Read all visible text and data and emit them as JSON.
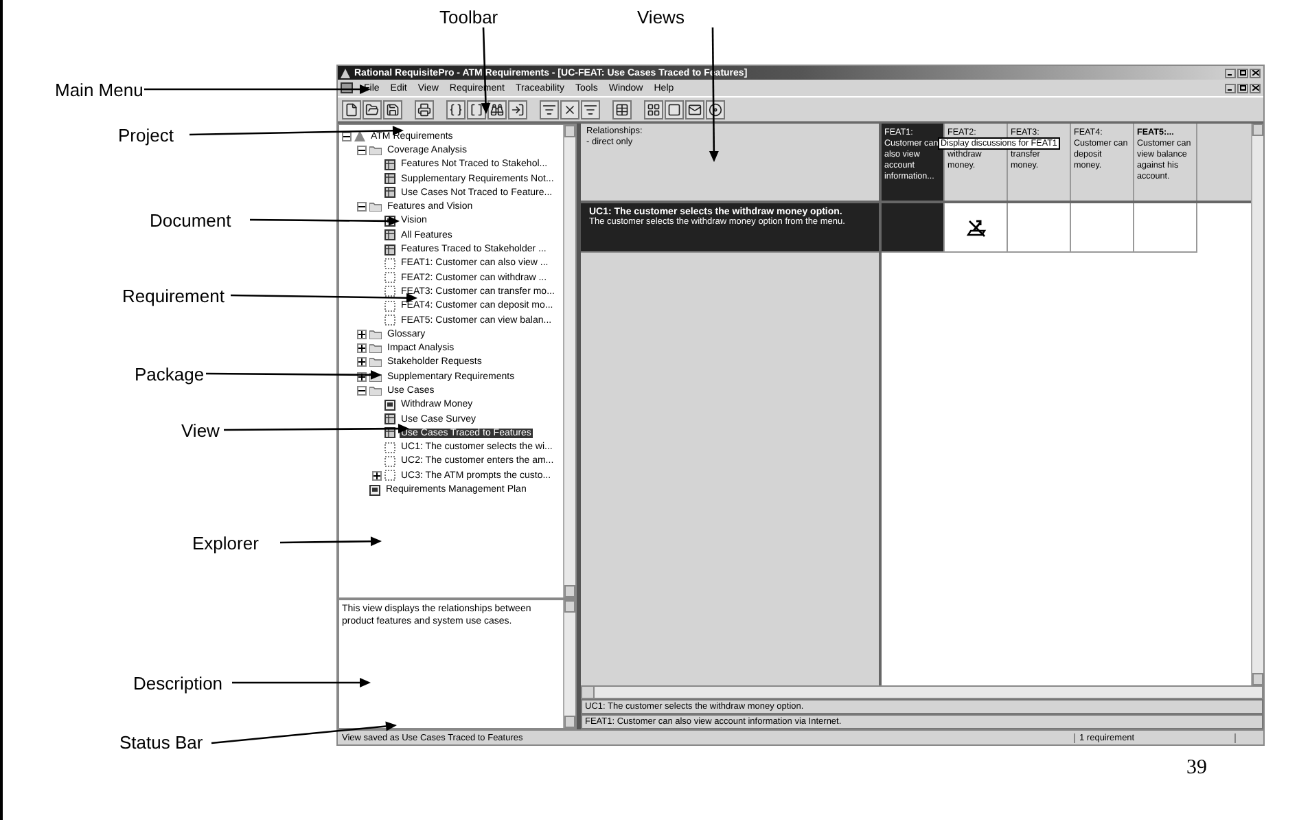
{
  "slide": {
    "page_number": "39",
    "annotations": [
      {
        "label": "Toolbar"
      },
      {
        "label": "Views"
      },
      {
        "label": "Main Menu"
      },
      {
        "label": "Project"
      },
      {
        "label": "Document"
      },
      {
        "label": "Requirement"
      },
      {
        "label": "Package"
      },
      {
        "label": "View"
      },
      {
        "label": "Explorer"
      },
      {
        "label": "Description"
      },
      {
        "label": "Status Bar"
      }
    ]
  },
  "window": {
    "title": "Rational RequisitePro - ATM Requirements - [UC-FEAT: Use Cases Traced to Features]"
  },
  "menu": [
    "File",
    "Edit",
    "View",
    "Requirement",
    "Traceability",
    "Tools",
    "Window",
    "Help"
  ],
  "explorer": {
    "tree": [
      {
        "label": "ATM Requirements",
        "kind": "project",
        "expanded": true,
        "selected": false,
        "children": [
          {
            "label": "Coverage Analysis",
            "kind": "package",
            "expanded": true,
            "selected": false,
            "children": [
              {
                "label": "Features Not Traced to Stakehol...",
                "kind": "view",
                "selected": false
              },
              {
                "label": "Supplementary Requirements Not...",
                "kind": "view",
                "selected": false
              },
              {
                "label": "Use Cases Not Traced to Feature...",
                "kind": "view",
                "selected": false
              }
            ]
          },
          {
            "label": "Features and Vision",
            "kind": "package",
            "expanded": true,
            "selected": false,
            "children": [
              {
                "label": "Vision",
                "kind": "document",
                "selected": false
              },
              {
                "label": "All Features",
                "kind": "view",
                "selected": false
              },
              {
                "label": "Features Traced to Stakeholder ...",
                "kind": "view",
                "selected": false
              },
              {
                "label": "FEAT1: Customer can also view ...",
                "kind": "requirement",
                "selected": false
              },
              {
                "label": "FEAT2: Customer can withdraw ...",
                "kind": "requirement",
                "selected": false
              },
              {
                "label": "FEAT3: Customer can transfer mo...",
                "kind": "requirement",
                "selected": false
              },
              {
                "label": "FEAT4: Customer can deposit mo...",
                "kind": "requirement",
                "selected": false
              },
              {
                "label": "FEAT5: Customer can view balan...",
                "kind": "requirement",
                "selected": false
              }
            ]
          },
          {
            "label": "Glossary",
            "kind": "package",
            "expanded": false,
            "selected": false
          },
          {
            "label": "Impact Analysis",
            "kind": "package",
            "expanded": false,
            "selected": false
          },
          {
            "label": "Stakeholder Requests",
            "kind": "package",
            "expanded": false,
            "selected": false
          },
          {
            "label": "Supplementary Requirements",
            "kind": "package",
            "expanded": false,
            "selected": false
          },
          {
            "label": "Use Cases",
            "kind": "package",
            "expanded": true,
            "selected": false,
            "children": [
              {
                "label": "Withdraw Money",
                "kind": "document",
                "selected": false
              },
              {
                "label": "Use Case Survey",
                "kind": "view",
                "selected": false
              },
              {
                "label": "Use Cases Traced to Features",
                "kind": "view",
                "selected": true
              },
              {
                "label": "UC1: The customer selects the wi...",
                "kind": "requirement",
                "selected": false
              },
              {
                "label": "UC2: The customer enters the am...",
                "kind": "requirement",
                "selected": false
              },
              {
                "label": "UC3: The ATM prompts the custo...",
                "kind": "requirement",
                "expanded": false,
                "selected": false
              }
            ]
          },
          {
            "label": "Requirements Management Plan",
            "kind": "document",
            "selected": false
          }
        ]
      }
    ],
    "description": "This view displays the relationships between product features and system use cases."
  },
  "matrix": {
    "filter": [
      "Relationships:",
      "- direct only"
    ],
    "columns": [
      {
        "title": "FEAT1:",
        "subtitle": "Customer can",
        "text": "also view account information...",
        "selected": true,
        "bold": false
      },
      {
        "title": "FEAT2:",
        "text": "withdraw money.",
        "selected": false,
        "bold": false
      },
      {
        "title": "FEAT3:",
        "text": "transfer money.",
        "selected": false,
        "bold": false
      },
      {
        "title": "FEAT4:",
        "subtitle": "Customer can",
        "text": "deposit money.",
        "selected": false,
        "bold": false
      },
      {
        "title": "FEAT5:...",
        "subtitle": "Customer can",
        "text": "view balance against his account.",
        "selected": false,
        "bold": true
      }
    ],
    "tooltip": "Display discussions for FEAT1",
    "rows": [
      {
        "title": "UC1: The customer selects the withdraw money option.",
        "text": "The customer selects the withdraw money option from the menu.",
        "selected": true,
        "cells": [
          {
            "kind": "empty"
          },
          {
            "kind": "suspect"
          },
          {
            "kind": "empty"
          },
          {
            "kind": "empty"
          },
          {
            "kind": "empty"
          }
        ]
      }
    ],
    "info_lines": [
      "UC1: The customer selects the withdraw money option.",
      "FEAT1: Customer can also view account information via Internet."
    ]
  },
  "status_bar": {
    "message": "View saved as Use Cases Traced to Features",
    "count": "1 requirement"
  }
}
